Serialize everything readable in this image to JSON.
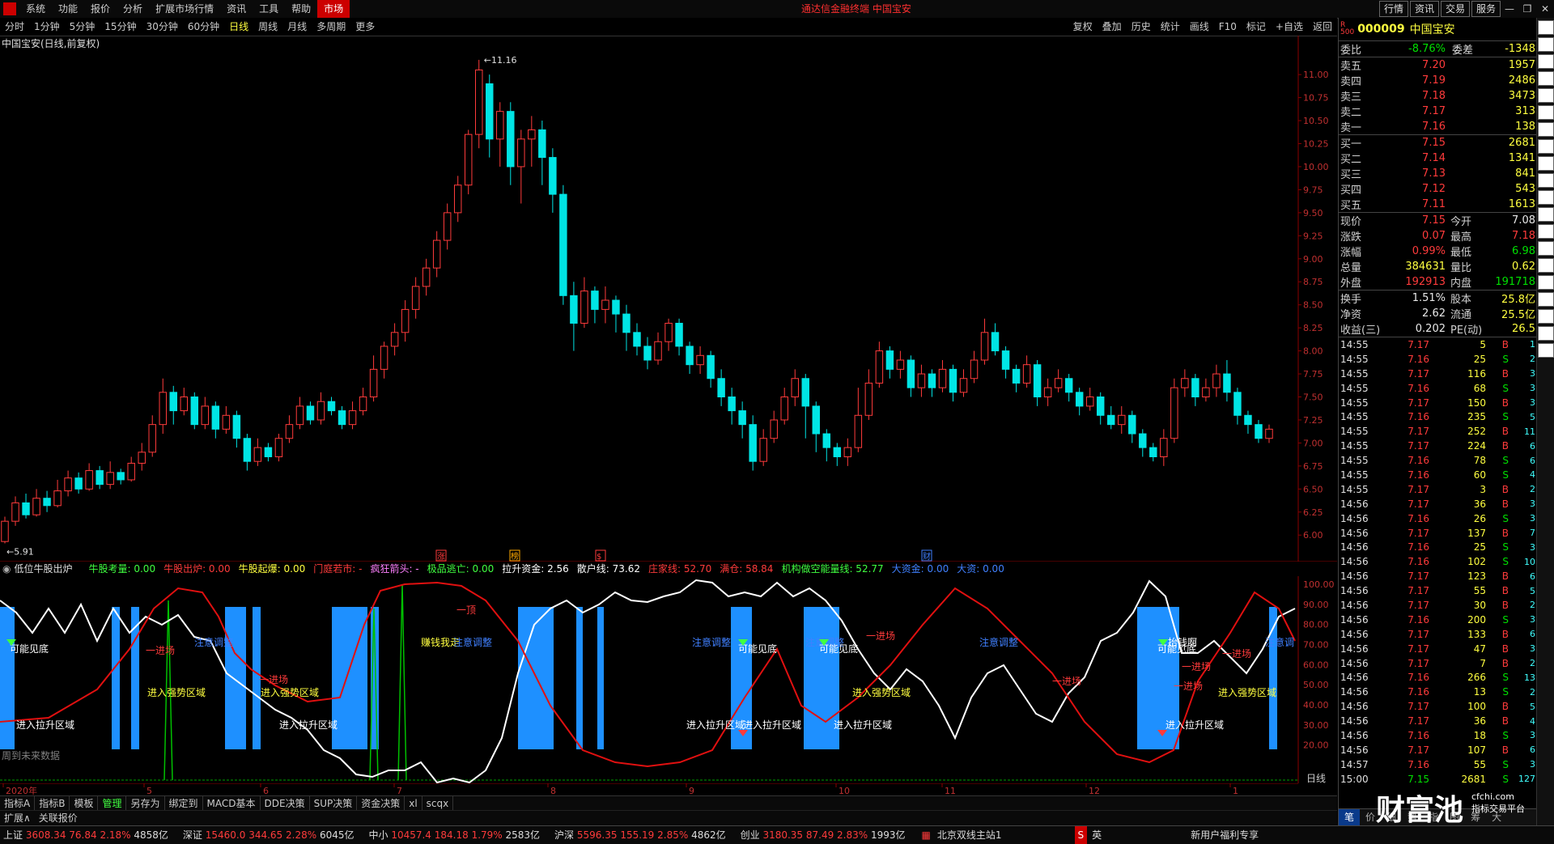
{
  "menu": [
    "系统",
    "功能",
    "报价",
    "分析",
    "扩展市场行情",
    "资讯",
    "工具",
    "帮助",
    "市场"
  ],
  "window_title": "通达信金融终端  中国宝安",
  "top_buttons": [
    "行情",
    "资讯",
    "交易",
    "服务"
  ],
  "periods": [
    "分时",
    "1分钟",
    "5分钟",
    "15分钟",
    "30分钟",
    "60分钟",
    "日线",
    "周线",
    "月线",
    "多周期",
    "更多"
  ],
  "selected_period": "日线",
  "tools": [
    "复权",
    "叠加",
    "历史",
    "统计",
    "画线",
    "F10",
    "标记",
    "+自选",
    "返回"
  ],
  "chart": {
    "title": "中国宝安(日线,前复权)",
    "y_ticks": [
      "11.00",
      "10.75",
      "10.50",
      "10.25",
      "10.00",
      "9.75",
      "9.50",
      "9.25",
      "9.00",
      "8.75",
      "8.50",
      "8.25",
      "8.00",
      "7.75",
      "7.50",
      "7.25",
      "7.00",
      "6.75",
      "6.50",
      "6.25",
      "6.00"
    ],
    "high_label": "11.16",
    "low_label": "5.91",
    "markers": [
      "涨",
      "榜",
      "$",
      "财"
    ]
  },
  "chart_data": {
    "type": "candlestick",
    "ylim": [
      5.8,
      11.3
    ],
    "candles": [
      [
        5.93,
        6.15,
        5.91,
        6.2
      ],
      [
        6.15,
        6.35,
        6.1,
        6.42
      ],
      [
        6.35,
        6.22,
        6.18,
        6.45
      ],
      [
        6.22,
        6.4,
        6.2,
        6.5
      ],
      [
        6.4,
        6.32,
        6.25,
        6.48
      ],
      [
        6.32,
        6.48,
        6.3,
        6.6
      ],
      [
        6.48,
        6.62,
        6.42,
        6.7
      ],
      [
        6.62,
        6.5,
        6.45,
        6.68
      ],
      [
        6.5,
        6.7,
        6.48,
        6.78
      ],
      [
        6.7,
        6.55,
        6.5,
        6.75
      ],
      [
        6.55,
        6.68,
        6.5,
        6.8
      ],
      [
        6.68,
        6.6,
        6.55,
        6.72
      ],
      [
        6.6,
        6.78,
        6.58,
        6.85
      ],
      [
        6.78,
        6.9,
        6.7,
        7.0
      ],
      [
        6.9,
        7.2,
        6.85,
        7.3
      ],
      [
        7.2,
        7.55,
        7.1,
        7.7
      ],
      [
        7.55,
        7.35,
        7.2,
        7.62
      ],
      [
        7.35,
        7.5,
        7.3,
        7.6
      ],
      [
        7.5,
        7.2,
        7.15,
        7.55
      ],
      [
        7.2,
        7.4,
        7.15,
        7.5
      ],
      [
        7.4,
        7.15,
        7.05,
        7.45
      ],
      [
        7.15,
        7.3,
        7.1,
        7.4
      ],
      [
        7.3,
        7.05,
        6.95,
        7.35
      ],
      [
        7.05,
        6.8,
        6.7,
        7.1
      ],
      [
        6.8,
        6.95,
        6.75,
        7.05
      ],
      [
        6.95,
        6.85,
        6.8,
        7.0
      ],
      [
        6.85,
        7.05,
        6.8,
        7.1
      ],
      [
        7.05,
        7.2,
        7.0,
        7.3
      ],
      [
        7.2,
        7.4,
        7.15,
        7.5
      ],
      [
        7.4,
        7.25,
        7.2,
        7.45
      ],
      [
        7.25,
        7.45,
        7.2,
        7.55
      ],
      [
        7.45,
        7.35,
        7.3,
        7.5
      ],
      [
        7.35,
        7.2,
        7.15,
        7.4
      ],
      [
        7.2,
        7.35,
        7.15,
        7.45
      ],
      [
        7.35,
        7.5,
        7.3,
        7.6
      ],
      [
        7.5,
        7.8,
        7.45,
        7.95
      ],
      [
        7.8,
        8.05,
        7.7,
        8.1
      ],
      [
        8.05,
        8.2,
        7.95,
        8.3
      ],
      [
        8.2,
        8.45,
        8.1,
        8.55
      ],
      [
        8.45,
        8.7,
        8.35,
        8.8
      ],
      [
        8.7,
        8.9,
        8.6,
        9.0
      ],
      [
        8.9,
        9.2,
        8.8,
        9.3
      ],
      [
        9.2,
        9.5,
        9.1,
        9.6
      ],
      [
        9.5,
        9.8,
        9.4,
        9.9
      ],
      [
        9.8,
        10.35,
        9.7,
        10.4
      ],
      [
        10.35,
        11.05,
        10.2,
        11.16
      ],
      [
        10.9,
        10.3,
        10.1,
        11.0
      ],
      [
        10.3,
        10.6,
        10.0,
        10.7
      ],
      [
        10.6,
        10.0,
        9.8,
        10.7
      ],
      [
        10.0,
        10.3,
        9.6,
        10.4
      ],
      [
        10.3,
        10.4,
        10.0,
        10.55
      ],
      [
        10.4,
        10.1,
        9.8,
        10.5
      ],
      [
        10.1,
        9.7,
        9.5,
        10.2
      ],
      [
        9.7,
        8.6,
        8.5,
        9.8
      ],
      [
        8.6,
        8.3,
        8.0,
        8.75
      ],
      [
        8.3,
        8.65,
        8.25,
        8.8
      ],
      [
        8.65,
        8.45,
        8.3,
        8.7
      ],
      [
        8.45,
        8.55,
        8.3,
        8.7
      ],
      [
        8.55,
        8.4,
        8.2,
        8.6
      ],
      [
        8.4,
        8.2,
        8.0,
        8.5
      ],
      [
        8.2,
        8.05,
        7.95,
        8.3
      ],
      [
        8.05,
        7.9,
        7.8,
        8.15
      ],
      [
        7.9,
        8.1,
        7.85,
        8.2
      ],
      [
        8.1,
        8.3,
        8.0,
        8.35
      ],
      [
        8.3,
        8.05,
        7.95,
        8.35
      ],
      [
        8.05,
        7.85,
        7.75,
        8.1
      ],
      [
        7.85,
        7.95,
        7.75,
        8.05
      ],
      [
        7.95,
        7.7,
        7.6,
        8.0
      ],
      [
        7.7,
        7.5,
        7.4,
        7.8
      ],
      [
        7.5,
        7.35,
        7.2,
        7.6
      ],
      [
        7.35,
        7.2,
        7.05,
        7.45
      ],
      [
        7.2,
        6.8,
        6.7,
        7.3
      ],
      [
        6.8,
        7.05,
        6.75,
        7.15
      ],
      [
        7.05,
        7.25,
        7.0,
        7.35
      ],
      [
        7.25,
        7.5,
        7.2,
        7.6
      ],
      [
        7.5,
        7.7,
        7.4,
        7.8
      ],
      [
        7.7,
        7.4,
        7.05,
        7.75
      ],
      [
        7.4,
        7.1,
        6.9,
        7.45
      ],
      [
        7.1,
        6.95,
        6.8,
        7.15
      ],
      [
        6.95,
        6.85,
        6.75,
        7.0
      ],
      [
        6.85,
        6.95,
        6.75,
        7.05
      ],
      [
        6.95,
        7.3,
        6.9,
        7.6
      ],
      [
        7.3,
        7.65,
        7.25,
        7.8
      ],
      [
        7.65,
        8.0,
        7.6,
        8.1
      ],
      [
        8.0,
        7.8,
        7.7,
        8.05
      ],
      [
        7.8,
        7.9,
        7.7,
        8.0
      ],
      [
        7.9,
        7.6,
        7.5,
        7.95
      ],
      [
        7.6,
        7.75,
        7.5,
        7.85
      ],
      [
        7.75,
        7.6,
        7.5,
        7.8
      ],
      [
        7.6,
        7.8,
        7.55,
        7.9
      ],
      [
        7.8,
        7.55,
        7.45,
        7.85
      ],
      [
        7.55,
        7.7,
        7.5,
        7.8
      ],
      [
        7.7,
        7.9,
        7.65,
        8.0
      ],
      [
        7.9,
        8.2,
        7.85,
        8.35
      ],
      [
        8.2,
        8.0,
        7.95,
        8.3
      ],
      [
        8.0,
        7.8,
        7.7,
        8.05
      ],
      [
        7.8,
        7.65,
        7.55,
        7.85
      ],
      [
        7.65,
        7.85,
        7.6,
        7.95
      ],
      [
        7.85,
        7.5,
        7.4,
        7.9
      ],
      [
        7.5,
        7.6,
        7.4,
        7.7
      ],
      [
        7.6,
        7.7,
        7.55,
        7.8
      ],
      [
        7.7,
        7.55,
        7.45,
        7.75
      ],
      [
        7.55,
        7.4,
        7.3,
        7.6
      ],
      [
        7.4,
        7.5,
        7.35,
        7.6
      ],
      [
        7.5,
        7.3,
        7.2,
        7.55
      ],
      [
        7.3,
        7.2,
        7.15,
        7.4
      ],
      [
        7.2,
        7.3,
        7.1,
        7.4
      ],
      [
        7.3,
        7.1,
        7.0,
        7.35
      ],
      [
        7.1,
        6.95,
        6.85,
        7.15
      ],
      [
        6.95,
        6.85,
        6.8,
        7.0
      ],
      [
        6.85,
        7.05,
        6.75,
        7.15
      ],
      [
        7.05,
        7.6,
        7.0,
        7.7
      ],
      [
        7.6,
        7.7,
        7.5,
        7.8
      ],
      [
        7.7,
        7.5,
        7.4,
        7.75
      ],
      [
        7.5,
        7.6,
        7.45,
        7.7
      ],
      [
        7.6,
        7.75,
        7.5,
        7.85
      ],
      [
        7.75,
        7.55,
        7.45,
        7.9
      ],
      [
        7.55,
        7.3,
        7.2,
        7.6
      ],
      [
        7.3,
        7.2,
        7.1,
        7.35
      ],
      [
        7.2,
        7.05,
        7.0,
        7.25
      ],
      [
        7.05,
        7.15,
        7.0,
        7.2
      ]
    ]
  },
  "indicator": {
    "name": "低位牛股出炉",
    "items": [
      {
        "text": "牛股考量: 0.00",
        "color": "#40ff40"
      },
      {
        "text": "牛股出炉: 0.00",
        "color": "#ff3b3b"
      },
      {
        "text": "牛股起爆: 0.00",
        "color": "#ffff40"
      },
      {
        "text": "门庭若市: -",
        "color": "#ff3b3b"
      },
      {
        "text": "疯狂箭头: -",
        "color": "#ff80ff"
      },
      {
        "text": "极品逃亡: 0.00",
        "color": "#40ff40"
      },
      {
        "text": "拉升资金: 2.56",
        "color": "#ffffff"
      },
      {
        "text": "散户线: 73.62",
        "color": "#ffffff"
      },
      {
        "text": "庄家线: 52.70",
        "color": "#ff3b3b"
      },
      {
        "text": "满仓: 58.84",
        "color": "#ff3b3b"
      },
      {
        "text": "机构做空能量线: 52.77",
        "color": "#40ff40"
      },
      {
        "text": "大资金: 0.00",
        "color": "#4080ff"
      },
      {
        "text": "大资: 0.00",
        "color": "#4080ff"
      }
    ],
    "y_ticks": [
      "100.00",
      "90.00",
      "80.00",
      "70.00",
      "60.00",
      "50.00",
      "40.00",
      "30.00",
      "20.00"
    ],
    "labels": [
      {
        "t": "可能见底",
        "c": "#ffffff"
      },
      {
        "t": "一进场",
        "c": "#ff3b3b"
      },
      {
        "t": "注意调整",
        "c": "#4080ff"
      },
      {
        "t": "进入强势区域",
        "c": "#ffff40"
      },
      {
        "t": "进入拉升区域",
        "c": "#ffffff"
      },
      {
        "t": "一进场",
        "c": "#ff3b3b"
      },
      {
        "t": "进入强势区域",
        "c": "#ffff40"
      },
      {
        "t": "进入拉升区域",
        "c": "#ffffff"
      },
      {
        "t": "一顶",
        "c": "#ff3b3b"
      },
      {
        "t": "赚钱我走",
        "c": "#ffff40"
      },
      {
        "t": "注意调整",
        "c": "#4080ff"
      },
      {
        "t": "注意调整",
        "c": "#4080ff"
      },
      {
        "t": "可能见底",
        "c": "#ffffff"
      },
      {
        "t": "进入拉升区域",
        "c": "#ffffff"
      },
      {
        "t": "进入拉升区域",
        "c": "#ffffff"
      },
      {
        "t": "注意调整",
        "c": "#4080ff"
      },
      {
        "t": "可能见底",
        "c": "#ffffff"
      },
      {
        "t": "一进场",
        "c": "#ff3b3b"
      },
      {
        "t": "进入强势区域",
        "c": "#ffff40"
      },
      {
        "t": "进入拉升区域",
        "c": "#ffffff"
      },
      {
        "t": "注意调整",
        "c": "#4080ff"
      },
      {
        "t": "一进场",
        "c": "#ff3b3b"
      },
      {
        "t": "可能见底",
        "c": "#ffffff"
      },
      {
        "t": "抬钱啊",
        "c": "#ffffff"
      },
      {
        "t": "一进场",
        "c": "#ff3b3b"
      },
      {
        "t": "一进场",
        "c": "#ff3b3b"
      },
      {
        "t": "一进场",
        "c": "#ff3b3b"
      },
      {
        "t": "进入强势区域",
        "c": "#ffff40"
      },
      {
        "t": "进入拉升区域",
        "c": "#ffffff"
      },
      {
        "t": "注意调",
        "c": "#4080ff"
      },
      {
        "t": "周到未来数据",
        "c": "#808080"
      }
    ],
    "period_label": "日线"
  },
  "dates": [
    "2020年",
    "5",
    "6",
    "7",
    "8",
    "9",
    "10",
    "11",
    "12",
    "1"
  ],
  "bottom_tabs": [
    "指标A",
    "指标B",
    "模板",
    "管理",
    "另存为",
    "绑定到",
    "MACD基本",
    "DDE决策",
    "SUP决策",
    "资金决策",
    "xl",
    "scqx"
  ],
  "ext_tabs": [
    "扩展∧",
    "关联报价"
  ],
  "status": {
    "indices": [
      {
        "name": "上证",
        "val": "3608.34",
        "chg": "76.84",
        "pct": "2.18%",
        "amt": "4858亿"
      },
      {
        "name": "深证",
        "val": "15460.0",
        "chg": "344.65",
        "pct": "2.28%",
        "amt": "6045亿"
      },
      {
        "name": "中小",
        "val": "10457.4",
        "chg": "184.18",
        "pct": "1.79%",
        "amt": "2583亿"
      },
      {
        "name": "沪深",
        "val": "5596.35",
        "chg": "155.19",
        "pct": "2.85%",
        "amt": "4862亿"
      },
      {
        "name": "创业",
        "val": "3180.35",
        "chg": "87.49",
        "pct": "2.83%",
        "amt": "1993亿"
      }
    ],
    "server": "北京双线主站1",
    "promo": "新用户福利专享",
    "ime": "英"
  },
  "quote": {
    "code": "000009",
    "name": "中国宝安",
    "wb": {
      "label": "委比",
      "pct": "-8.76%",
      "diff_label": "委差",
      "diff": "-1348"
    },
    "asks": [
      {
        "l": "卖五",
        "p": "7.20",
        "v": "1957"
      },
      {
        "l": "卖四",
        "p": "7.19",
        "v": "2486"
      },
      {
        "l": "卖三",
        "p": "7.18",
        "v": "3473"
      },
      {
        "l": "卖二",
        "p": "7.17",
        "v": "313"
      },
      {
        "l": "卖一",
        "p": "7.16",
        "v": "138"
      }
    ],
    "bids": [
      {
        "l": "买一",
        "p": "7.15",
        "v": "2681"
      },
      {
        "l": "买二",
        "p": "7.14",
        "v": "1341"
      },
      {
        "l": "买三",
        "p": "7.13",
        "v": "841"
      },
      {
        "l": "买四",
        "p": "7.12",
        "v": "543"
      },
      {
        "l": "买五",
        "p": "7.11",
        "v": "1613"
      }
    ],
    "stats": [
      {
        "a": "现价",
        "av": "7.15",
        "ac": "red",
        "b": "今开",
        "bv": "7.08",
        "bc": "white"
      },
      {
        "a": "涨跌",
        "av": "0.07",
        "ac": "red",
        "b": "最高",
        "bv": "7.18",
        "bc": "red"
      },
      {
        "a": "涨幅",
        "av": "0.99%",
        "ac": "red",
        "b": "最低",
        "bv": "6.98",
        "bc": "green"
      },
      {
        "a": "总量",
        "av": "384631",
        "ac": "yellow",
        "b": "量比",
        "bv": "0.62",
        "bc": "yellow"
      },
      {
        "a": "外盘",
        "av": "192913",
        "ac": "red",
        "b": "内盘",
        "bv": "191718",
        "bc": "green"
      }
    ],
    "fin": [
      {
        "a": "换手",
        "av": "1.51%",
        "b": "股本",
        "bv": "25.8亿"
      },
      {
        "a": "净资",
        "av": "2.62",
        "b": "流通",
        "bv": "25.5亿"
      },
      {
        "a": "收益(三)",
        "av": "0.202",
        "b": "PE(动)",
        "bv": "26.5"
      }
    ],
    "ticks": [
      [
        "14:55",
        "7.17",
        "5",
        "B",
        "1"
      ],
      [
        "14:55",
        "7.16",
        "25",
        "S",
        "2"
      ],
      [
        "14:55",
        "7.17",
        "116",
        "B",
        "3"
      ],
      [
        "14:55",
        "7.16",
        "68",
        "S",
        "3"
      ],
      [
        "14:55",
        "7.17",
        "150",
        "B",
        "3"
      ],
      [
        "14:55",
        "7.16",
        "235",
        "S",
        "5"
      ],
      [
        "14:55",
        "7.17",
        "252",
        "B",
        "11"
      ],
      [
        "14:55",
        "7.17",
        "224",
        "B",
        "6"
      ],
      [
        "14:55",
        "7.16",
        "78",
        "S",
        "6"
      ],
      [
        "14:55",
        "7.16",
        "60",
        "S",
        "4"
      ],
      [
        "14:55",
        "7.17",
        "3",
        "B",
        "2"
      ],
      [
        "14:56",
        "7.17",
        "36",
        "B",
        "3"
      ],
      [
        "14:56",
        "7.16",
        "26",
        "S",
        "3"
      ],
      [
        "14:56",
        "7.17",
        "137",
        "B",
        "7"
      ],
      [
        "14:56",
        "7.16",
        "25",
        "S",
        "3"
      ],
      [
        "14:56",
        "7.16",
        "102",
        "S",
        "10"
      ],
      [
        "14:56",
        "7.17",
        "123",
        "B",
        "6"
      ],
      [
        "14:56",
        "7.17",
        "55",
        "B",
        "5"
      ],
      [
        "14:56",
        "7.17",
        "30",
        "B",
        "2"
      ],
      [
        "14:56",
        "7.16",
        "200",
        "S",
        "3"
      ],
      [
        "14:56",
        "7.17",
        "133",
        "B",
        "6"
      ],
      [
        "14:56",
        "7.17",
        "47",
        "B",
        "3"
      ],
      [
        "14:56",
        "7.17",
        "7",
        "B",
        "2"
      ],
      [
        "14:56",
        "7.16",
        "266",
        "S",
        "13"
      ],
      [
        "14:56",
        "7.16",
        "13",
        "S",
        "2"
      ],
      [
        "14:56",
        "7.17",
        "100",
        "B",
        "5"
      ],
      [
        "14:56",
        "7.17",
        "36",
        "B",
        "4"
      ],
      [
        "14:56",
        "7.16",
        "18",
        "S",
        "3"
      ],
      [
        "14:56",
        "7.17",
        "107",
        "B",
        "6"
      ],
      [
        "14:57",
        "7.16",
        "55",
        "S",
        "3"
      ],
      [
        "15:00",
        "7.15",
        "2681",
        "S",
        "127"
      ]
    ],
    "tabs": [
      "笔",
      "价",
      "细",
      "势",
      "指",
      "图",
      "筹",
      "大"
    ]
  },
  "watermark": {
    "text": "财富池",
    "sub": "cfchi.com",
    "sub2": "指标交易平台"
  }
}
